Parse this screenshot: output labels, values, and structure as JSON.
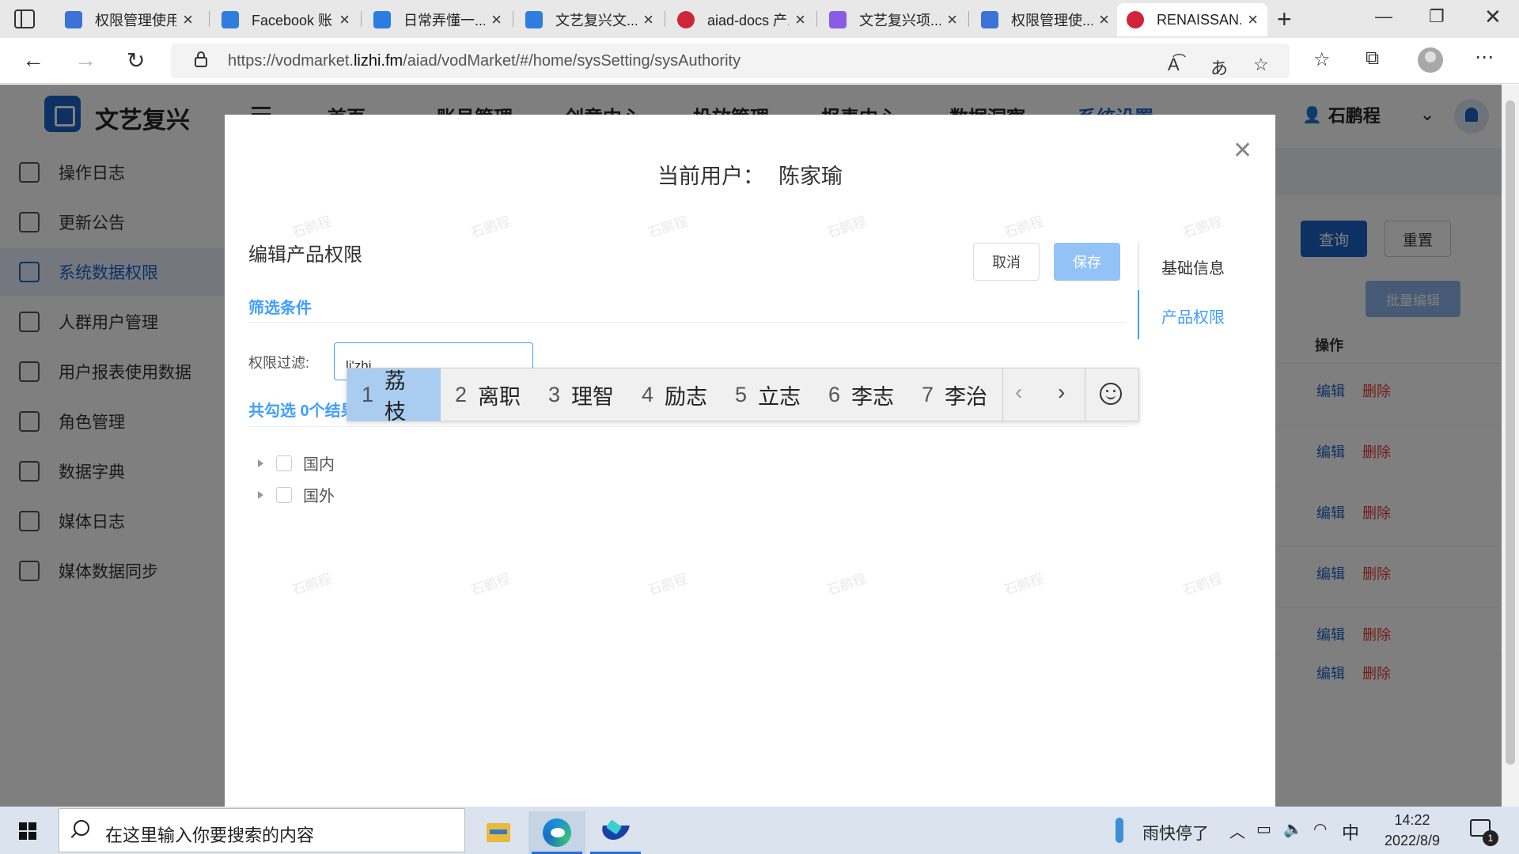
{
  "browser": {
    "tabs": [
      {
        "label": "权限管理使用...",
        "icon_color": "#3b73d6",
        "active": false
      },
      {
        "label": "Facebook 账...",
        "icon_color": "#2f7de1",
        "active": false
      },
      {
        "label": "日常弄懂一...",
        "icon_color": "#2a7de1",
        "active": false
      },
      {
        "label": "文艺复兴文...",
        "icon_color": "#2f7de1",
        "active": false
      },
      {
        "label": "aiad-docs 产...",
        "icon_color": "#d0243a",
        "active": false
      },
      {
        "label": "文艺复兴项...",
        "icon_color": "#8a5ce6",
        "active": false
      },
      {
        "label": "权限管理使...",
        "icon_color": "#3b73d6",
        "active": false
      },
      {
        "label": "RENAISSAN...",
        "icon_color": "#d0243a",
        "active": true
      }
    ],
    "url_prefix": "https://vodmarket.",
    "url_domain": "lizhi.fm",
    "url_path": "/aiad/vodMarket/#/home/sysSetting/sysAuthority",
    "icons": {
      "back": "back-arrow-icon",
      "forward": "forward-arrow-icon",
      "refresh": "refresh-icon",
      "read_aloud": "read-aloud-icon",
      "translate": "translate-icon",
      "add_favorite": "add-favorite-icon",
      "favorites": "favorites-icon",
      "collections": "collections-icon",
      "more": "more-icon"
    }
  },
  "app": {
    "logo_text": "文艺复兴",
    "topnav": [
      "首页",
      "账号管理",
      "创意中心",
      "投放管理",
      "报表中心",
      "数据洞察",
      "系统设置"
    ],
    "active_topnav": "系统设置",
    "user_name": "石鹏程",
    "sidebar": [
      {
        "label": "操作日志"
      },
      {
        "label": "更新公告"
      },
      {
        "label": "系统数据权限"
      },
      {
        "label": "人群用户管理"
      },
      {
        "label": "用户报表使用数据"
      },
      {
        "label": "角色管理"
      },
      {
        "label": "数据字典"
      },
      {
        "label": "媒体日志"
      },
      {
        "label": "媒体数据同步"
      }
    ],
    "active_sidebar": "系统数据权限",
    "query_label": "查询",
    "reset_label": "重置",
    "batch_edit_label": "批量编辑",
    "ops_column": "操作",
    "row_edit": "编辑",
    "row_delete": "删除",
    "row_count": 6
  },
  "modal": {
    "title_label": "当前用户：",
    "title_user": "陈家瑜",
    "section_title": "编辑产品权限",
    "cancel_label": "取消",
    "save_label": "保存",
    "filter_header": "筛选条件",
    "filter_label": "权限过滤:",
    "filter_value": "li'zhi",
    "selected_count": "共勾选 0个结果",
    "tree": [
      {
        "label": "国内",
        "checked": false
      },
      {
        "label": "国外",
        "checked": false
      }
    ],
    "right_tabs": [
      "基础信息",
      "产品权限"
    ],
    "active_right_tab": "产品权限",
    "watermark": "石鹏程"
  },
  "ime": {
    "candidates": [
      {
        "num": "1",
        "text": "荔枝",
        "selected": true
      },
      {
        "num": "2",
        "text": "离职",
        "selected": false
      },
      {
        "num": "3",
        "text": "理智",
        "selected": false
      },
      {
        "num": "4",
        "text": "励志",
        "selected": false
      },
      {
        "num": "5",
        "text": "立志",
        "selected": false
      },
      {
        "num": "6",
        "text": "李志",
        "selected": false
      },
      {
        "num": "7",
        "text": "李治",
        "selected": false
      }
    ]
  },
  "taskbar": {
    "search_placeholder": "在这里输入你要搜索的内容",
    "weather": "雨快停了",
    "ime_indicator": "中",
    "time": "14:22",
    "date": "2022/8/9",
    "notifications": "1"
  }
}
